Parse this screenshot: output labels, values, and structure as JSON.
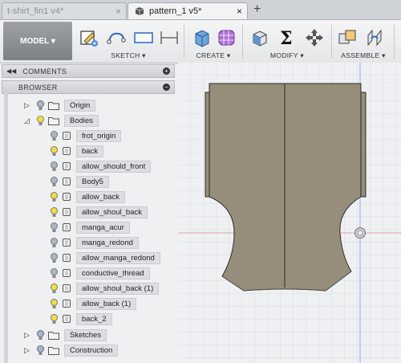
{
  "tabs": [
    {
      "label": "t-shirt_fin1 v4*",
      "close": "×"
    },
    {
      "label": "pattern_1 v5*",
      "close": "×"
    }
  ],
  "new_tab": "+",
  "toolbar": {
    "model_label": "MODEL ▾",
    "groups": [
      "SKETCH ▾",
      "CREATE ▾",
      "MODIFY ▾",
      "ASSEMBLE ▾"
    ]
  },
  "panels": {
    "comments": {
      "label": "COMMENTS",
      "button": "+",
      "chevron": "◀◀"
    },
    "browser": {
      "label": "BROWSER",
      "button": "−"
    }
  },
  "tree": {
    "origin": "Origin",
    "bodies": "Bodies",
    "body_items": [
      {
        "label": "frot_origin",
        "bulb_color": "#a9b6c6"
      },
      {
        "label": "back",
        "bulb_color": "#f2df3c"
      },
      {
        "label": "allow_should_front",
        "bulb_color": "#a9b6c6"
      },
      {
        "label": "Body5",
        "bulb_color": "#a9b6c6"
      },
      {
        "label": "allow_back",
        "bulb_color": "#f2df3c"
      },
      {
        "label": "allow_shoul_back",
        "bulb_color": "#f2df3c"
      },
      {
        "label": "manga_acur",
        "bulb_color": "#a9b6c6"
      },
      {
        "label": "manga_redond",
        "bulb_color": "#a9b6c6"
      },
      {
        "label": "allow_manga_redond",
        "bulb_color": "#a9b6c6"
      },
      {
        "label": "conductive_thread",
        "bulb_color": "#a9b6c6"
      },
      {
        "label": "allow_shoul_back (1)",
        "bulb_color": "#f2df3c"
      },
      {
        "label": "allow_back (1)",
        "bulb_color": "#f2df3c"
      },
      {
        "label": "back_2",
        "bulb_color": "#f2df3c"
      }
    ],
    "sketches": "Sketches",
    "construction": "Construction"
  },
  "colors": {
    "shape_fill": "#968e7b",
    "shape_stroke": "#2b2b2b",
    "grid": "#d5d9de",
    "axis_red": "#e8a0a0",
    "axis_blue": "#9ea6e6"
  }
}
